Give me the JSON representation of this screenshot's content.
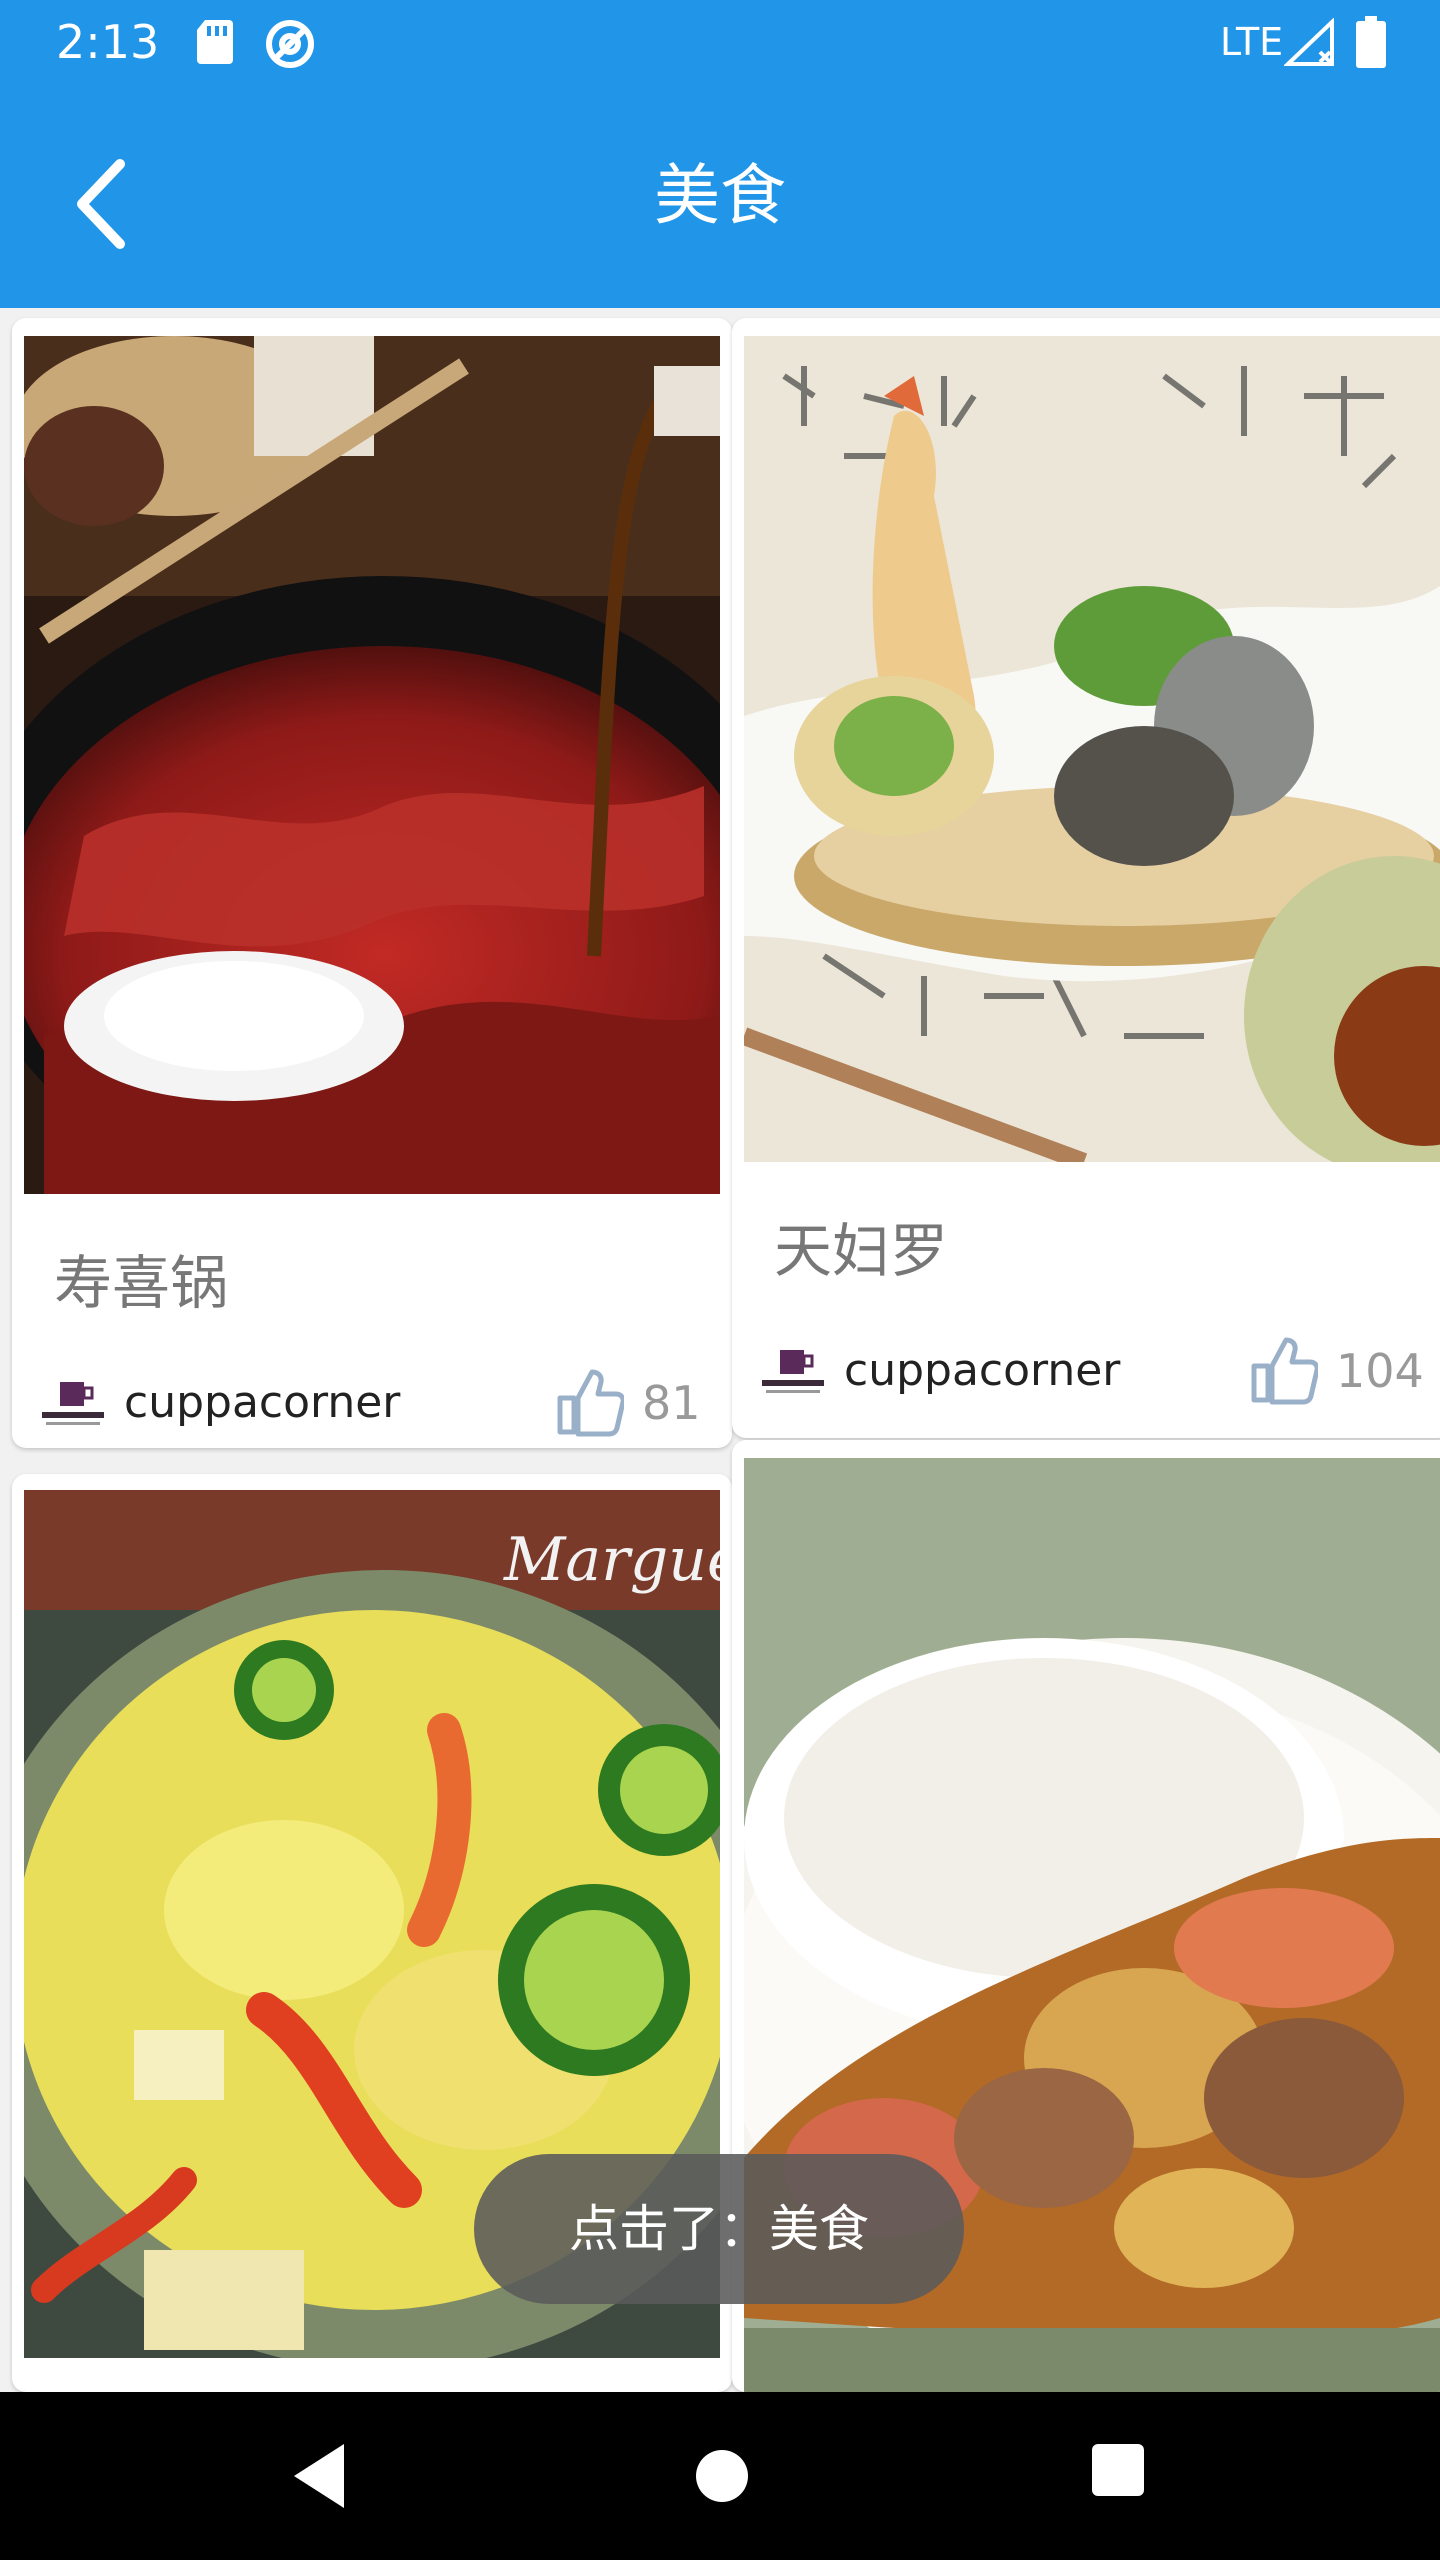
{
  "status_bar": {
    "time": "2:13",
    "network": "LTE",
    "icons": [
      "sd-card-icon",
      "sync-icon",
      "signal-icon",
      "battery-icon"
    ]
  },
  "toolbar": {
    "title": "美食",
    "back_icon": "chevron-left-icon"
  },
  "cards": [
    {
      "title": "寿喜锅",
      "author": "cuppacorner",
      "likes": "81",
      "image": "sukiyaki-photo"
    },
    {
      "title": "天妇罗",
      "author": "cuppacorner",
      "likes": "104",
      "image": "tempura-photo"
    },
    {
      "title": "",
      "author": "",
      "likes": "",
      "image": "potato-salad-photo",
      "watermark": "Marguerite"
    },
    {
      "title": "",
      "author": "",
      "likes": "",
      "image": "curry-rice-photo"
    }
  ],
  "toast": "点击了：美食",
  "nav_bar": {
    "icons": [
      "back-triangle-icon",
      "home-circle-icon",
      "recents-square-icon"
    ]
  },
  "colors": {
    "primary": "#2196e8",
    "like_icon": "#9ab0c8",
    "nav_bar": "#000000"
  }
}
